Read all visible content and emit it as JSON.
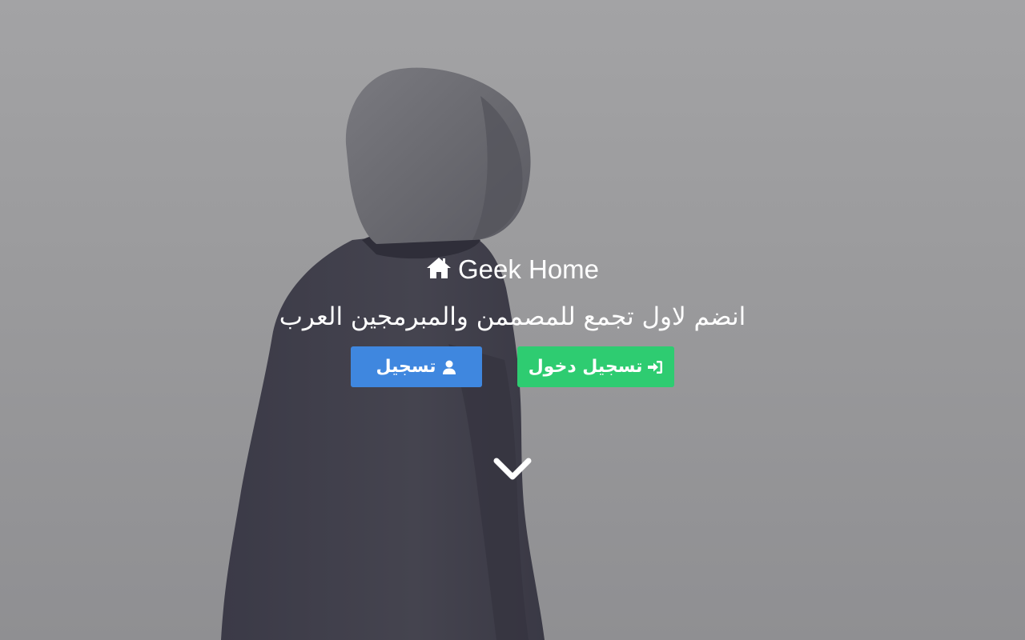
{
  "brand": {
    "icon": "home-icon",
    "name": "Geek Home"
  },
  "hero": {
    "tagline": "انضم لاول تجمع للمصممن والمبرمجين العرب",
    "background": "hooded-person-photo"
  },
  "buttons": {
    "signup": {
      "label": "تسجيل",
      "icon": "user-icon",
      "color": "#3f87df"
    },
    "login": {
      "label": "تسجيل دخول",
      "icon": "sign-in-icon",
      "color": "#2ecc71"
    }
  },
  "scroll": {
    "icon": "chevron-down-icon"
  },
  "colors": {
    "background": "#9b9b9d",
    "text": "#ffffff",
    "jacket": "#3e3d4a"
  }
}
